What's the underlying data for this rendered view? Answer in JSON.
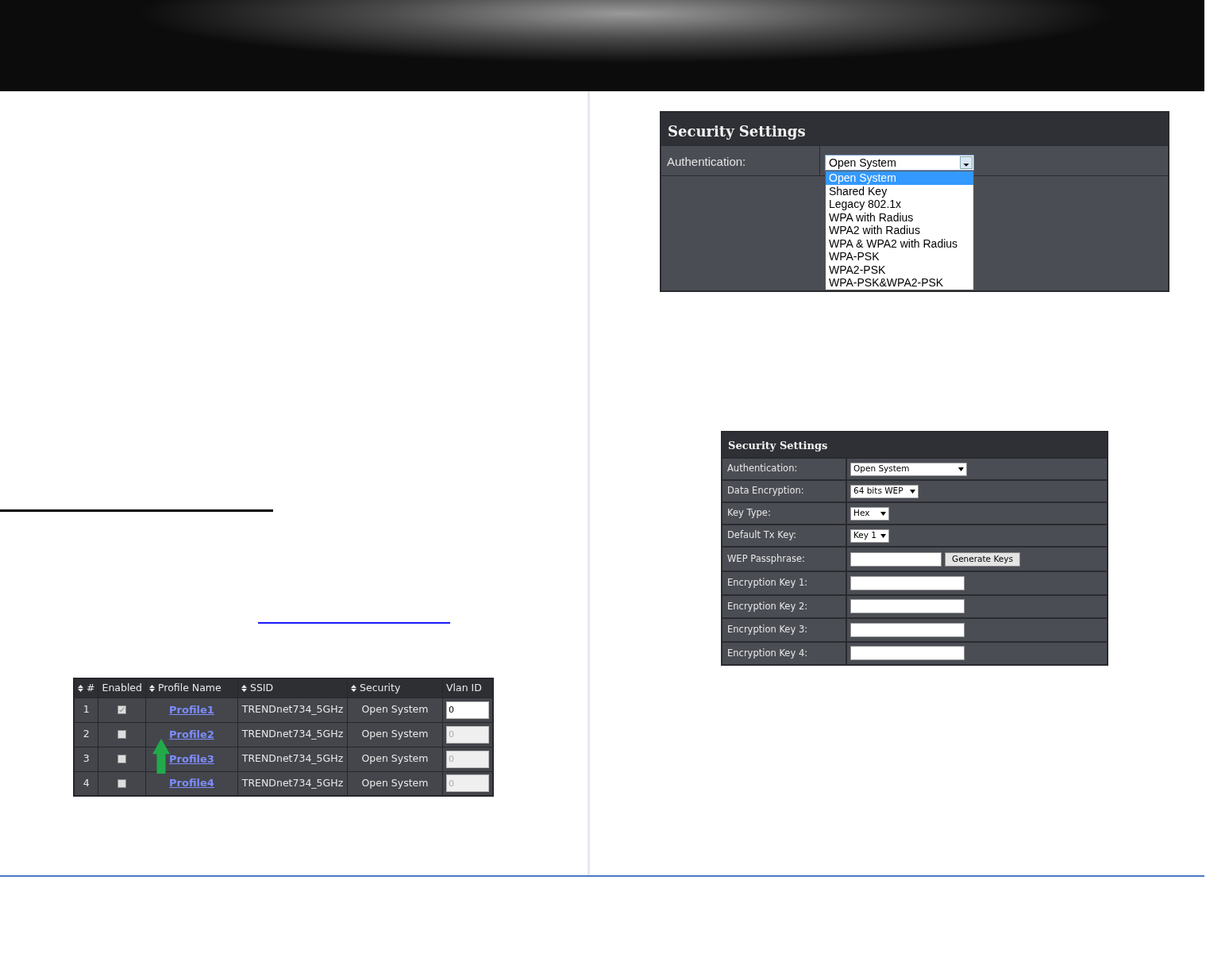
{
  "auth_panel": {
    "title": "Security Settings",
    "label": "Authentication:",
    "value": "Open System",
    "options": [
      {
        "label": "Open System",
        "selected": true
      },
      {
        "label": "Shared Key",
        "selected": false
      },
      {
        "label": "Legacy 802.1x",
        "selected": false
      },
      {
        "label": "WPA with Radius",
        "selected": false
      },
      {
        "label": "WPA2 with Radius",
        "selected": false
      },
      {
        "label": "WPA & WPA2 with Radius",
        "selected": false
      },
      {
        "label": "WPA-PSK",
        "selected": false
      },
      {
        "label": "WPA2-PSK",
        "selected": false
      },
      {
        "label": "WPA-PSK&WPA2-PSK",
        "selected": false
      }
    ]
  },
  "wep_panel": {
    "title": "Security Settings",
    "rows": [
      {
        "kind": "select",
        "label": "Authentication:",
        "value": "Open System"
      },
      {
        "kind": "select",
        "label": "Data Encryption:",
        "value": "64 bits WEP"
      },
      {
        "kind": "select",
        "label": "Key Type:",
        "value": "Hex"
      },
      {
        "kind": "select",
        "label": "Default Tx Key:",
        "value": "Key 1"
      },
      {
        "kind": "passphrase",
        "label": "WEP Passphrase:",
        "button": "Generate Keys"
      },
      {
        "kind": "input",
        "label": "Encryption Key 1:"
      },
      {
        "kind": "input",
        "label": "Encryption Key 2:"
      },
      {
        "kind": "input",
        "label": "Encryption Key 3:"
      },
      {
        "kind": "input",
        "label": "Encryption Key 4:"
      }
    ]
  },
  "profiles_table": {
    "columns": [
      {
        "label": "#",
        "sortable": true
      },
      {
        "label": "Enabled",
        "sortable": false
      },
      {
        "label": "Profile Name",
        "sortable": true
      },
      {
        "label": "SSID",
        "sortable": true
      },
      {
        "label": "Security",
        "sortable": true
      },
      {
        "label": "Vlan ID",
        "sortable": false
      }
    ],
    "rows": [
      {
        "number": "1",
        "checked": true,
        "profile": "Profile1",
        "ssid": "TRENDnet734_5GHz",
        "security": "Open System",
        "vlan": "0",
        "disabled": false
      },
      {
        "number": "2",
        "checked": false,
        "profile": "Profile2",
        "ssid": "TRENDnet734_5GHz",
        "security": "Open System",
        "vlan": "0",
        "disabled": true
      },
      {
        "number": "3",
        "checked": false,
        "profile": "Profile3",
        "ssid": "TRENDnet734_5GHz",
        "security": "Open System",
        "vlan": "0",
        "disabled": true
      },
      {
        "number": "4",
        "checked": false,
        "profile": "Profile4",
        "ssid": "TRENDnet734_5GHz",
        "security": "Open System",
        "vlan": "0",
        "disabled": true
      }
    ]
  }
}
